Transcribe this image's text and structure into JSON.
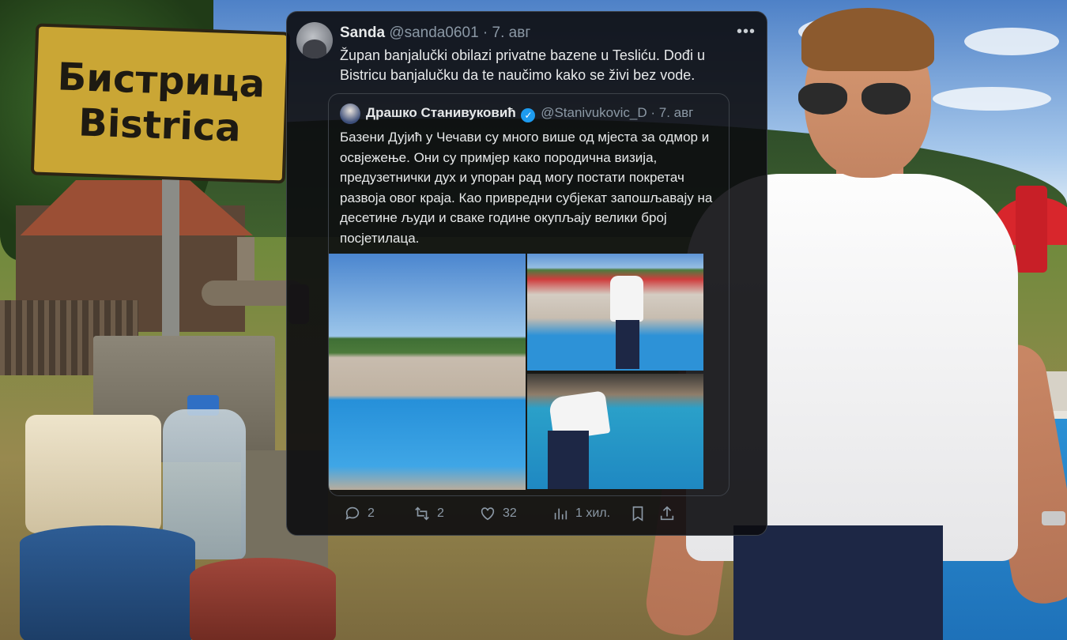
{
  "sign": {
    "line1": "Бистрица",
    "line2": "Bistrica"
  },
  "tweet": {
    "name": "Sanda",
    "handle": "@sanda0601",
    "separator": "·",
    "date": "7. авг",
    "more_label": "•••",
    "text": "Župan banjalučki obilazi privatne bazene u Tesliću. Dođi u Bistricu banjalučku da te naučimo kako se živi bez vode.",
    "quote": {
      "name": "Драшко Станивуковић",
      "verified_mark": "✓",
      "handle": "@Stanivukovic_D",
      "date": "7. авг",
      "text": "Базени Дујић у Чечави су много више од мјеста за одмор и освјежење. Они су примјер како породична визија, предузетнички дух и упоран рад могу постати покретач развоја овог краја. Као привредни субјекат запошљавају на десетине људи и сваке године окупљају велики број посјетилаца."
    },
    "actions": {
      "replies": "2",
      "reposts": "2",
      "likes": "32",
      "views": "1 хил."
    }
  },
  "icons": {
    "reply": "reply-icon",
    "repost": "repost-icon",
    "like": "heart-icon",
    "views": "views-icon",
    "bookmark": "bookmark-icon",
    "share": "share-icon",
    "verified": "verified-badge-icon",
    "more": "more-icon"
  },
  "colors": {
    "tweet_bg": "#0c0c10",
    "text_primary": "#e7e9ea",
    "text_secondary": "#8b98a5",
    "verified": "#1d9bf0",
    "sign_yellow": "#caa635"
  }
}
